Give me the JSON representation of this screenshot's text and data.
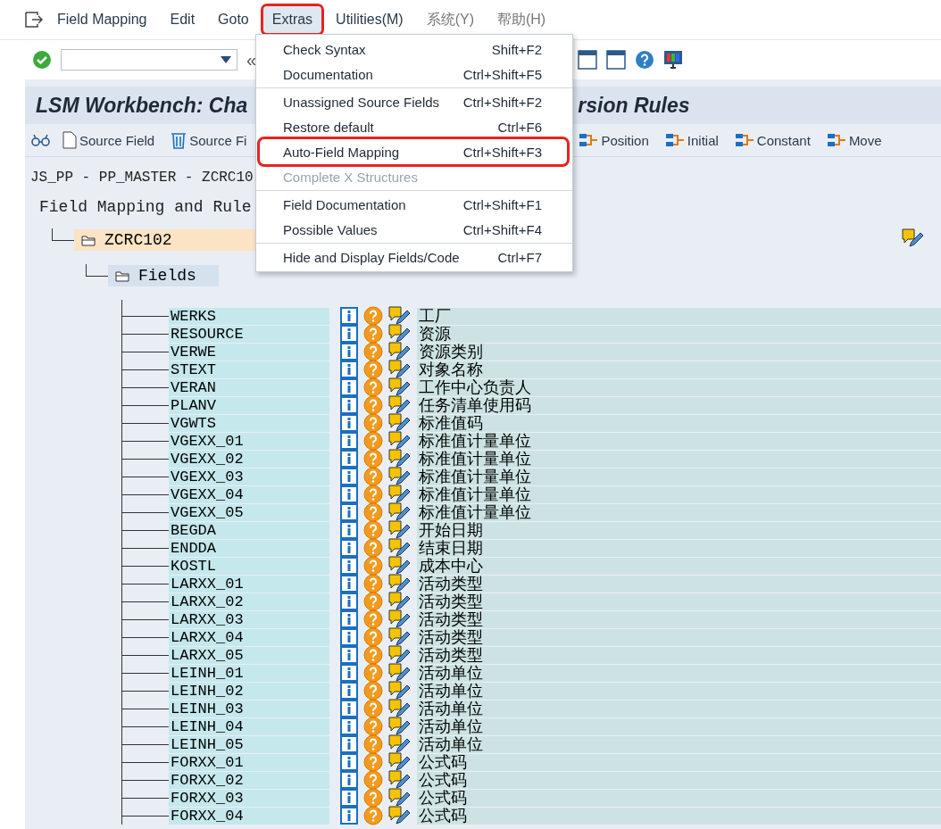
{
  "menu_bar": [
    {
      "label": "Field Mapping",
      "selected": false
    },
    {
      "label": "Edit",
      "selected": false
    },
    {
      "label": "Goto",
      "selected": false
    },
    {
      "label": "Extras",
      "selected": true
    },
    {
      "label": "Utilities(M)",
      "selected": false
    },
    {
      "label": "系统(Y)",
      "selected": false
    },
    {
      "label": "帮助(H)",
      "selected": false
    }
  ],
  "system_toolbar": {
    "collapse_label": "«"
  },
  "title": {
    "left": "LSM Workbench: Cha",
    "right": "rsion Rules"
  },
  "app_toolbar": {
    "left": [
      {
        "label": "Source Field"
      },
      {
        "label": "Source Fi"
      }
    ],
    "right": [
      {
        "label": "Position"
      },
      {
        "label": "Initial"
      },
      {
        "label": "Constant"
      },
      {
        "label": "Move"
      }
    ]
  },
  "breadcrumb": "JS_PP - PP_MASTER - ZCRC10",
  "tree": {
    "title": "Field Mapping and Rule",
    "root": {
      "label": "ZCRC102",
      "children": [
        {
          "label": "Fields",
          "rows": [
            {
              "field": "WERKS",
              "description": "工厂"
            },
            {
              "field": "RESOURCE",
              "description": "资源"
            },
            {
              "field": "VERWE",
              "description": "资源类别"
            },
            {
              "field": "STEXT",
              "description": "对象名称"
            },
            {
              "field": "VERAN",
              "description": "工作中心负责人"
            },
            {
              "field": "PLANV",
              "description": "任务清单使用码"
            },
            {
              "field": "VGWTS",
              "description": "标准值码"
            },
            {
              "field": "VGEXX_01",
              "description": "标准值计量单位"
            },
            {
              "field": "VGEXX_02",
              "description": "标准值计量单位"
            },
            {
              "field": "VGEXX_03",
              "description": "标准值计量单位"
            },
            {
              "field": "VGEXX_04",
              "description": "标准值计量单位"
            },
            {
              "field": "VGEXX_05",
              "description": "标准值计量单位"
            },
            {
              "field": "BEGDA",
              "description": "开始日期"
            },
            {
              "field": "ENDDA",
              "description": "结束日期"
            },
            {
              "field": "KOSTL",
              "description": "成本中心"
            },
            {
              "field": "LARXX_01",
              "description": "活动类型"
            },
            {
              "field": "LARXX_02",
              "description": "活动类型"
            },
            {
              "field": "LARXX_03",
              "description": "活动类型"
            },
            {
              "field": "LARXX_04",
              "description": "活动类型"
            },
            {
              "field": "LARXX_05",
              "description": "活动类型"
            },
            {
              "field": "LEINH_01",
              "description": "活动单位"
            },
            {
              "field": "LEINH_02",
              "description": "活动单位"
            },
            {
              "field": "LEINH_03",
              "description": "活动单位"
            },
            {
              "field": "LEINH_04",
              "description": "活动单位"
            },
            {
              "field": "LEINH_05",
              "description": "活动单位"
            },
            {
              "field": "FORXX_01",
              "description": "公式码"
            },
            {
              "field": "FORXX_02",
              "description": "公式码"
            },
            {
              "field": "FORXX_03",
              "description": "公式码"
            },
            {
              "field": "FORXX_04",
              "description": "公式码"
            }
          ]
        }
      ]
    }
  },
  "extras_menu": {
    "items": [
      {
        "kind": "item",
        "label": "Check Syntax",
        "shortcut": "Shift+F2",
        "disabled": false,
        "highlighted": false
      },
      {
        "kind": "item",
        "label": "Documentation",
        "shortcut": "Ctrl+Shift+F5",
        "disabled": false,
        "highlighted": false
      },
      {
        "kind": "separator"
      },
      {
        "kind": "item",
        "label": "Unassigned Source Fields",
        "shortcut": "Ctrl+Shift+F2",
        "disabled": false,
        "highlighted": false
      },
      {
        "kind": "item",
        "label": "Restore default",
        "shortcut": "Ctrl+F6",
        "disabled": false,
        "highlighted": false
      },
      {
        "kind": "item",
        "label": "Auto-Field Mapping",
        "shortcut": "Ctrl+Shift+F3",
        "disabled": false,
        "highlighted": true
      },
      {
        "kind": "item",
        "label": "Complete X Structures",
        "disabled": true,
        "highlighted": false
      },
      {
        "kind": "separator"
      },
      {
        "kind": "item",
        "label": "Field Documentation",
        "shortcut": "Ctrl+Shift+F1",
        "disabled": false,
        "highlighted": false
      },
      {
        "kind": "item",
        "label": "Possible Values",
        "shortcut": "Ctrl+Shift+F4",
        "disabled": false,
        "highlighted": false
      },
      {
        "kind": "separator"
      },
      {
        "kind": "item",
        "label": "Hide and Display Fields/Code",
        "shortcut": "Ctrl+F7",
        "disabled": false,
        "highlighted": false
      }
    ]
  }
}
